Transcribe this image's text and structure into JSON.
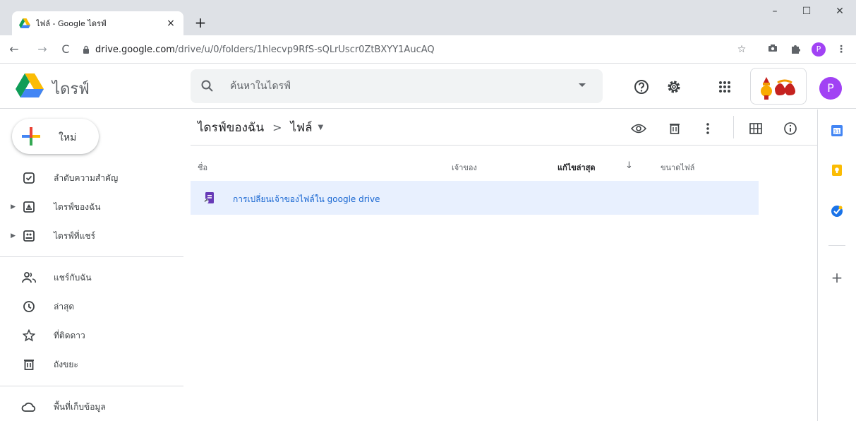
{
  "browser": {
    "tab_title": "ไฟล์ - Google ไดรฟ์",
    "tab_close": "×",
    "new_tab": "+",
    "url_host": "drive.google.com",
    "url_path": "/drive/u/0/folders/1hlecvp9RfS-sQLrUscr0ZtBXYY1AucAQ",
    "profile_initial": "P",
    "window_controls": {
      "minimize": "–",
      "maximize": "☐",
      "close": "✕"
    },
    "nav": {
      "back": "←",
      "forward": "→",
      "reload": "C"
    }
  },
  "header": {
    "app_name": "ไดรฟ์",
    "search_placeholder": "ค้นหาในไดรฟ์",
    "avatar_initial": "P",
    "icons": [
      "help-icon",
      "settings-icon",
      "apps-grid-icon"
    ]
  },
  "sidebar": {
    "new_label": "ใหม่",
    "items": [
      {
        "label": "ลำดับความสำคัญ",
        "icon": "priority-check-icon",
        "expandable": false
      },
      {
        "label": "ไดรฟ์ของฉัน",
        "icon": "my-drive-icon",
        "expandable": true
      },
      {
        "label": "ไดรฟ์ที่แชร์",
        "icon": "shared-drives-icon",
        "expandable": true
      },
      {
        "label": "แชร์กับฉัน",
        "icon": "shared-with-me-icon",
        "expandable": false
      },
      {
        "label": "ล่าสุด",
        "icon": "clock-icon",
        "expandable": false
      },
      {
        "label": "ที่ติดดาว",
        "icon": "star-icon",
        "expandable": false
      },
      {
        "label": "ถังขยะ",
        "icon": "trash-icon",
        "expandable": false
      },
      {
        "label": "พื้นที่เก็บข้อมูล",
        "icon": "cloud-icon",
        "expandable": false
      }
    ]
  },
  "main": {
    "breadcrumb": {
      "parent": "ไดรฟ์ของฉัน",
      "separator": ">",
      "current": "ไฟล์"
    },
    "columns": {
      "name": "ชื่อ",
      "owner": "เจ้าของ",
      "modified": "แก้ไขล่าสุด",
      "size": "ขนาดไฟล์"
    },
    "files": [
      {
        "name": "การเปลี่ยนเจ้าของไฟล์ใน google drive",
        "type": "form-shortcut"
      }
    ]
  },
  "side_panel": {
    "add": "+"
  },
  "colors": {
    "accent": "#1a73e8",
    "selected_row": "#e8f0fe",
    "avatar": "#a142f4",
    "chrome_bg": "#dee1e6"
  }
}
